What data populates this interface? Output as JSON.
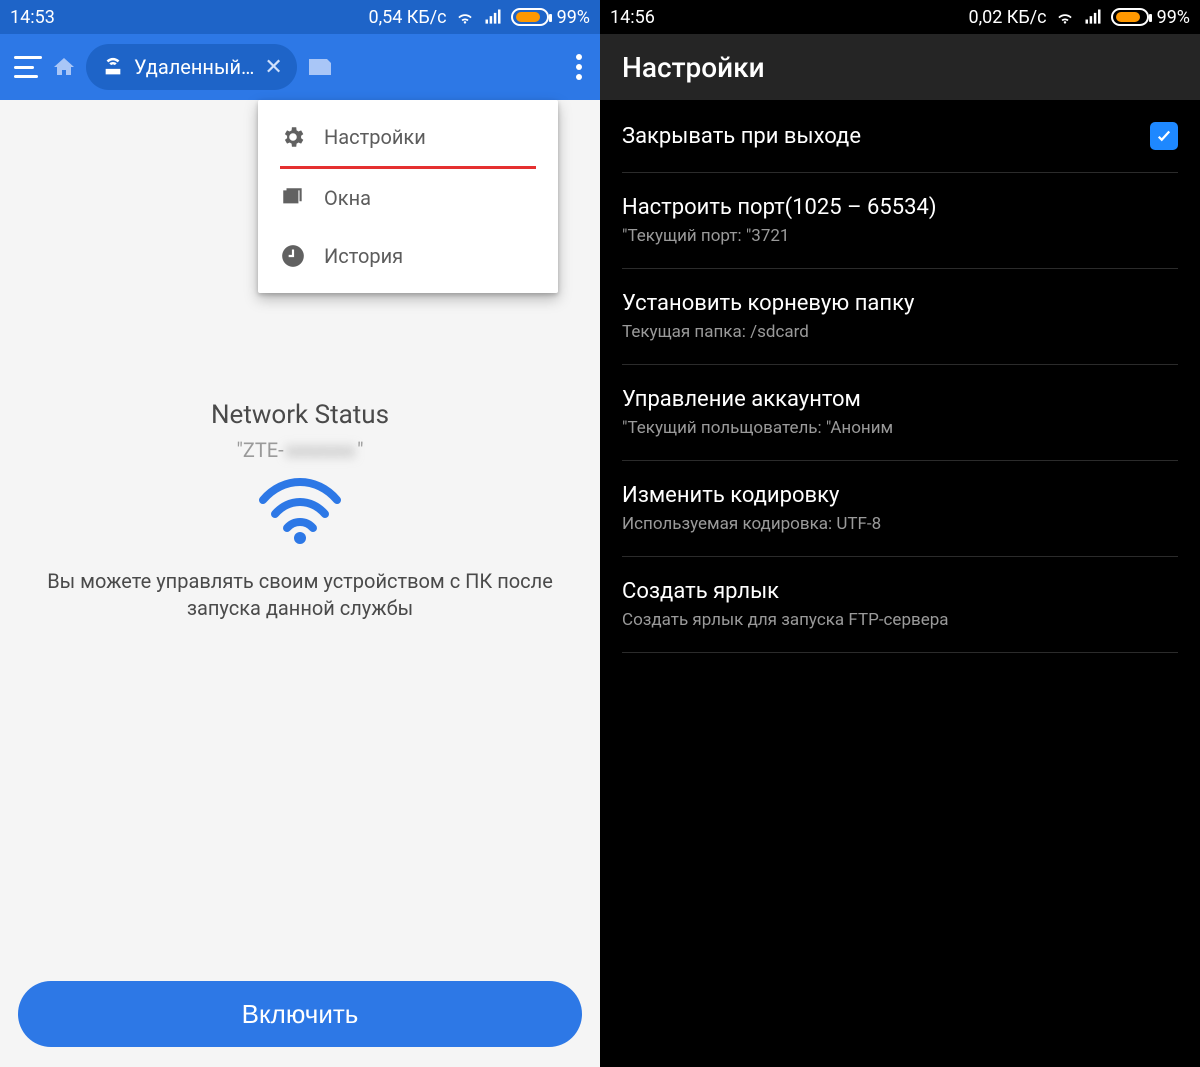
{
  "left": {
    "status": {
      "time": "14:53",
      "speed": "0,54 КБ/с",
      "battery_pct": "99%"
    },
    "appbar": {
      "tab_label": "Удаленный…"
    },
    "menu": {
      "settings": "Настройки",
      "windows": "Окна",
      "history": "История"
    },
    "content": {
      "title": "Network Status",
      "ssid_prefix": "\"ZTE-",
      "ssid_hidden": "xxxxxxx",
      "ssid_suffix": "\"",
      "description": "Вы можете управлять своим устройством с ПК после запуска данной службы"
    },
    "start_button": "Включить"
  },
  "right": {
    "status": {
      "time": "14:56",
      "speed": "0,02 КБ/с",
      "battery_pct": "99%"
    },
    "header": "Настройки",
    "items": [
      {
        "title": "Закрывать при выходе",
        "sub": "",
        "checkbox": true
      },
      {
        "title": "Настроить порт(1025 – 65534)",
        "sub": "\"Текущий порт: \"3721"
      },
      {
        "title": "Установить корневую папку",
        "sub": "Текущая папка: /sdcard"
      },
      {
        "title": "Управление аккаунтом",
        "sub": "\"Текущий польщователь: \"Аноним"
      },
      {
        "title": "Изменить кодировку",
        "sub": "Используемая кодировка: UTF-8"
      },
      {
        "title": "Создать ярлык",
        "sub": "Создать ярлык для запуска FTP-сервера"
      }
    ]
  }
}
